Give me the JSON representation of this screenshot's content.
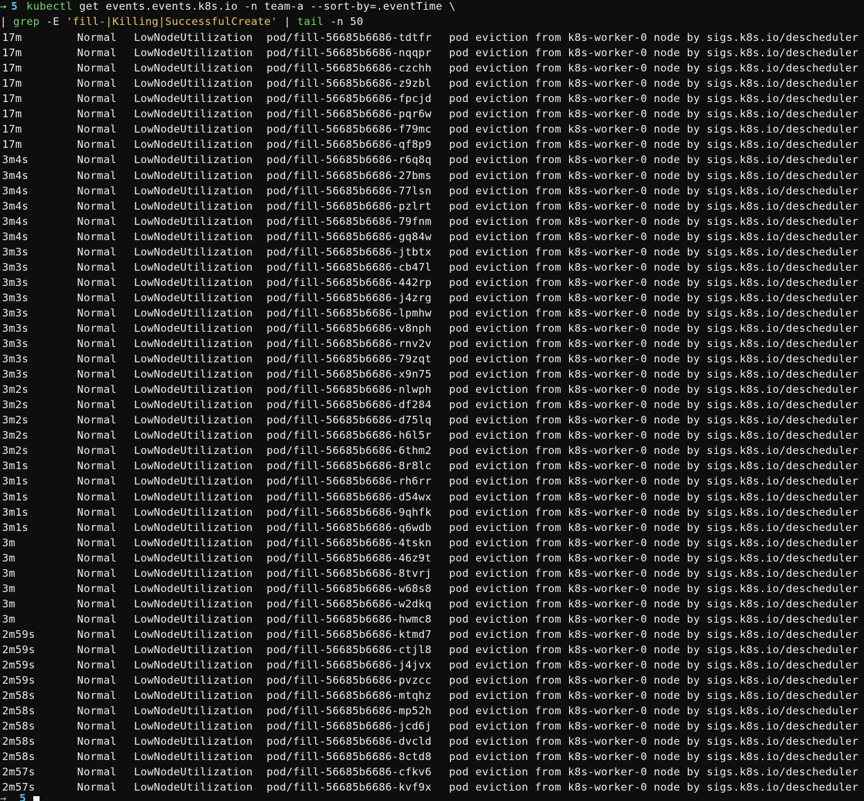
{
  "prompt": {
    "arrow": "→",
    "number": "5",
    "cursor_number": "5"
  },
  "command": {
    "line1_kubectl": "kubectl",
    "line1_rest": " get events.events.k8s.io -n team-a --sort-by=.eventTime \\",
    "line2_pipe1": "| ",
    "line2_grep": "grep",
    "line2_flag": " -E ",
    "line2_pattern": "'fill-|Killing|SuccessfulCreate'",
    "line2_pipe2": " | ",
    "line2_tail": "tail",
    "line2_tailargs": " -n 50"
  },
  "colors": {
    "background": "#0e0e0e",
    "text": "#ececec",
    "command_green": "#76d26f",
    "prompt_cyan": "#5ec8e6",
    "string_yellow": "#e6c46b"
  },
  "events": [
    {
      "age": "17m",
      "type": "Normal",
      "reason": "LowNodeUtilization",
      "object": "pod/fill-56685b6686-tdtfr",
      "message": "pod eviction from k8s-worker-0 node by sigs.k8s.io/descheduler"
    },
    {
      "age": "17m",
      "type": "Normal",
      "reason": "LowNodeUtilization",
      "object": "pod/fill-56685b6686-nqqpr",
      "message": "pod eviction from k8s-worker-0 node by sigs.k8s.io/descheduler"
    },
    {
      "age": "17m",
      "type": "Normal",
      "reason": "LowNodeUtilization",
      "object": "pod/fill-56685b6686-czchh",
      "message": "pod eviction from k8s-worker-0 node by sigs.k8s.io/descheduler"
    },
    {
      "age": "17m",
      "type": "Normal",
      "reason": "LowNodeUtilization",
      "object": "pod/fill-56685b6686-z9zbl",
      "message": "pod eviction from k8s-worker-0 node by sigs.k8s.io/descheduler"
    },
    {
      "age": "17m",
      "type": "Normal",
      "reason": "LowNodeUtilization",
      "object": "pod/fill-56685b6686-fpcjd",
      "message": "pod eviction from k8s-worker-0 node by sigs.k8s.io/descheduler"
    },
    {
      "age": "17m",
      "type": "Normal",
      "reason": "LowNodeUtilization",
      "object": "pod/fill-56685b6686-pqr6w",
      "message": "pod eviction from k8s-worker-0 node by sigs.k8s.io/descheduler"
    },
    {
      "age": "17m",
      "type": "Normal",
      "reason": "LowNodeUtilization",
      "object": "pod/fill-56685b6686-f79mc",
      "message": "pod eviction from k8s-worker-0 node by sigs.k8s.io/descheduler"
    },
    {
      "age": "17m",
      "type": "Normal",
      "reason": "LowNodeUtilization",
      "object": "pod/fill-56685b6686-qf8p9",
      "message": "pod eviction from k8s-worker-0 node by sigs.k8s.io/descheduler"
    },
    {
      "age": "3m4s",
      "type": "Normal",
      "reason": "LowNodeUtilization",
      "object": "pod/fill-56685b6686-r6q8q",
      "message": "pod eviction from k8s-worker-0 node by sigs.k8s.io/descheduler"
    },
    {
      "age": "3m4s",
      "type": "Normal",
      "reason": "LowNodeUtilization",
      "object": "pod/fill-56685b6686-27bms",
      "message": "pod eviction from k8s-worker-0 node by sigs.k8s.io/descheduler"
    },
    {
      "age": "3m4s",
      "type": "Normal",
      "reason": "LowNodeUtilization",
      "object": "pod/fill-56685b6686-77lsn",
      "message": "pod eviction from k8s-worker-0 node by sigs.k8s.io/descheduler"
    },
    {
      "age": "3m4s",
      "type": "Normal",
      "reason": "LowNodeUtilization",
      "object": "pod/fill-56685b6686-pzlrt",
      "message": "pod eviction from k8s-worker-0 node by sigs.k8s.io/descheduler"
    },
    {
      "age": "3m4s",
      "type": "Normal",
      "reason": "LowNodeUtilization",
      "object": "pod/fill-56685b6686-79fnm",
      "message": "pod eviction from k8s-worker-0 node by sigs.k8s.io/descheduler"
    },
    {
      "age": "3m4s",
      "type": "Normal",
      "reason": "LowNodeUtilization",
      "object": "pod/fill-56685b6686-gq84w",
      "message": "pod eviction from k8s-worker-0 node by sigs.k8s.io/descheduler"
    },
    {
      "age": "3m3s",
      "type": "Normal",
      "reason": "LowNodeUtilization",
      "object": "pod/fill-56685b6686-jtbtx",
      "message": "pod eviction from k8s-worker-0 node by sigs.k8s.io/descheduler"
    },
    {
      "age": "3m3s",
      "type": "Normal",
      "reason": "LowNodeUtilization",
      "object": "pod/fill-56685b6686-cb47l",
      "message": "pod eviction from k8s-worker-0 node by sigs.k8s.io/descheduler"
    },
    {
      "age": "3m3s",
      "type": "Normal",
      "reason": "LowNodeUtilization",
      "object": "pod/fill-56685b6686-442rp",
      "message": "pod eviction from k8s-worker-0 node by sigs.k8s.io/descheduler"
    },
    {
      "age": "3m3s",
      "type": "Normal",
      "reason": "LowNodeUtilization",
      "object": "pod/fill-56685b6686-j4zrg",
      "message": "pod eviction from k8s-worker-0 node by sigs.k8s.io/descheduler"
    },
    {
      "age": "3m3s",
      "type": "Normal",
      "reason": "LowNodeUtilization",
      "object": "pod/fill-56685b6686-lpmhw",
      "message": "pod eviction from k8s-worker-0 node by sigs.k8s.io/descheduler"
    },
    {
      "age": "3m3s",
      "type": "Normal",
      "reason": "LowNodeUtilization",
      "object": "pod/fill-56685b6686-v8nph",
      "message": "pod eviction from k8s-worker-0 node by sigs.k8s.io/descheduler"
    },
    {
      "age": "3m3s",
      "type": "Normal",
      "reason": "LowNodeUtilization",
      "object": "pod/fill-56685b6686-rnv2v",
      "message": "pod eviction from k8s-worker-0 node by sigs.k8s.io/descheduler"
    },
    {
      "age": "3m3s",
      "type": "Normal",
      "reason": "LowNodeUtilization",
      "object": "pod/fill-56685b6686-79zqt",
      "message": "pod eviction from k8s-worker-0 node by sigs.k8s.io/descheduler"
    },
    {
      "age": "3m3s",
      "type": "Normal",
      "reason": "LowNodeUtilization",
      "object": "pod/fill-56685b6686-x9n75",
      "message": "pod eviction from k8s-worker-0 node by sigs.k8s.io/descheduler"
    },
    {
      "age": "3m2s",
      "type": "Normal",
      "reason": "LowNodeUtilization",
      "object": "pod/fill-56685b6686-nlwph",
      "message": "pod eviction from k8s-worker-0 node by sigs.k8s.io/descheduler"
    },
    {
      "age": "3m2s",
      "type": "Normal",
      "reason": "LowNodeUtilization",
      "object": "pod/fill-56685b6686-df284",
      "message": "pod eviction from k8s-worker-0 node by sigs.k8s.io/descheduler"
    },
    {
      "age": "3m2s",
      "type": "Normal",
      "reason": "LowNodeUtilization",
      "object": "pod/fill-56685b6686-d75lq",
      "message": "pod eviction from k8s-worker-0 node by sigs.k8s.io/descheduler"
    },
    {
      "age": "3m2s",
      "type": "Normal",
      "reason": "LowNodeUtilization",
      "object": "pod/fill-56685b6686-h6l5r",
      "message": "pod eviction from k8s-worker-0 node by sigs.k8s.io/descheduler"
    },
    {
      "age": "3m2s",
      "type": "Normal",
      "reason": "LowNodeUtilization",
      "object": "pod/fill-56685b6686-6thm2",
      "message": "pod eviction from k8s-worker-0 node by sigs.k8s.io/descheduler"
    },
    {
      "age": "3m1s",
      "type": "Normal",
      "reason": "LowNodeUtilization",
      "object": "pod/fill-56685b6686-8r8lc",
      "message": "pod eviction from k8s-worker-0 node by sigs.k8s.io/descheduler"
    },
    {
      "age": "3m1s",
      "type": "Normal",
      "reason": "LowNodeUtilization",
      "object": "pod/fill-56685b6686-rh6rr",
      "message": "pod eviction from k8s-worker-0 node by sigs.k8s.io/descheduler"
    },
    {
      "age": "3m1s",
      "type": "Normal",
      "reason": "LowNodeUtilization",
      "object": "pod/fill-56685b6686-d54wx",
      "message": "pod eviction from k8s-worker-0 node by sigs.k8s.io/descheduler"
    },
    {
      "age": "3m1s",
      "type": "Normal",
      "reason": "LowNodeUtilization",
      "object": "pod/fill-56685b6686-9qhfk",
      "message": "pod eviction from k8s-worker-0 node by sigs.k8s.io/descheduler"
    },
    {
      "age": "3m1s",
      "type": "Normal",
      "reason": "LowNodeUtilization",
      "object": "pod/fill-56685b6686-q6wdb",
      "message": "pod eviction from k8s-worker-0 node by sigs.k8s.io/descheduler"
    },
    {
      "age": "3m",
      "type": "Normal",
      "reason": "LowNodeUtilization",
      "object": "pod/fill-56685b6686-4tskn",
      "message": "pod eviction from k8s-worker-0 node by sigs.k8s.io/descheduler"
    },
    {
      "age": "3m",
      "type": "Normal",
      "reason": "LowNodeUtilization",
      "object": "pod/fill-56685b6686-46z9t",
      "message": "pod eviction from k8s-worker-0 node by sigs.k8s.io/descheduler"
    },
    {
      "age": "3m",
      "type": "Normal",
      "reason": "LowNodeUtilization",
      "object": "pod/fill-56685b6686-8tvrj",
      "message": "pod eviction from k8s-worker-0 node by sigs.k8s.io/descheduler"
    },
    {
      "age": "3m",
      "type": "Normal",
      "reason": "LowNodeUtilization",
      "object": "pod/fill-56685b6686-w68s8",
      "message": "pod eviction from k8s-worker-0 node by sigs.k8s.io/descheduler"
    },
    {
      "age": "3m",
      "type": "Normal",
      "reason": "LowNodeUtilization",
      "object": "pod/fill-56685b6686-w2dkq",
      "message": "pod eviction from k8s-worker-0 node by sigs.k8s.io/descheduler"
    },
    {
      "age": "3m",
      "type": "Normal",
      "reason": "LowNodeUtilization",
      "object": "pod/fill-56685b6686-hwmc8",
      "message": "pod eviction from k8s-worker-0 node by sigs.k8s.io/descheduler"
    },
    {
      "age": "2m59s",
      "type": "Normal",
      "reason": "LowNodeUtilization",
      "object": "pod/fill-56685b6686-ktmd7",
      "message": "pod eviction from k8s-worker-0 node by sigs.k8s.io/descheduler"
    },
    {
      "age": "2m59s",
      "type": "Normal",
      "reason": "LowNodeUtilization",
      "object": "pod/fill-56685b6686-ctjl8",
      "message": "pod eviction from k8s-worker-0 node by sigs.k8s.io/descheduler"
    },
    {
      "age": "2m59s",
      "type": "Normal",
      "reason": "LowNodeUtilization",
      "object": "pod/fill-56685b6686-j4jvx",
      "message": "pod eviction from k8s-worker-0 node by sigs.k8s.io/descheduler"
    },
    {
      "age": "2m59s",
      "type": "Normal",
      "reason": "LowNodeUtilization",
      "object": "pod/fill-56685b6686-pvzcc",
      "message": "pod eviction from k8s-worker-0 node by sigs.k8s.io/descheduler"
    },
    {
      "age": "2m58s",
      "type": "Normal",
      "reason": "LowNodeUtilization",
      "object": "pod/fill-56685b6686-mtqhz",
      "message": "pod eviction from k8s-worker-0 node by sigs.k8s.io/descheduler"
    },
    {
      "age": "2m58s",
      "type": "Normal",
      "reason": "LowNodeUtilization",
      "object": "pod/fill-56685b6686-mp52h",
      "message": "pod eviction from k8s-worker-0 node by sigs.k8s.io/descheduler"
    },
    {
      "age": "2m58s",
      "type": "Normal",
      "reason": "LowNodeUtilization",
      "object": "pod/fill-56685b6686-jcd6j",
      "message": "pod eviction from k8s-worker-0 node by sigs.k8s.io/descheduler"
    },
    {
      "age": "2m58s",
      "type": "Normal",
      "reason": "LowNodeUtilization",
      "object": "pod/fill-56685b6686-dvcld",
      "message": "pod eviction from k8s-worker-0 node by sigs.k8s.io/descheduler"
    },
    {
      "age": "2m58s",
      "type": "Normal",
      "reason": "LowNodeUtilization",
      "object": "pod/fill-56685b6686-8ctd8",
      "message": "pod eviction from k8s-worker-0 node by sigs.k8s.io/descheduler"
    },
    {
      "age": "2m57s",
      "type": "Normal",
      "reason": "LowNodeUtilization",
      "object": "pod/fill-56685b6686-cfkv6",
      "message": "pod eviction from k8s-worker-0 node by sigs.k8s.io/descheduler"
    },
    {
      "age": "2m57s",
      "type": "Normal",
      "reason": "LowNodeUtilization",
      "object": "pod/fill-56685b6686-kvf9x",
      "message": "pod eviction from k8s-worker-0 node by sigs.k8s.io/descheduler"
    }
  ]
}
